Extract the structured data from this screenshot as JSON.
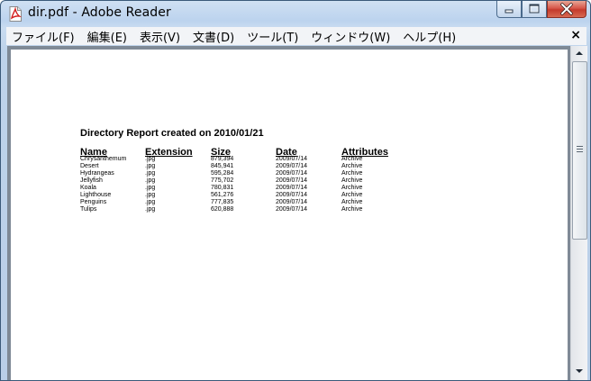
{
  "window": {
    "title": "dir.pdf - Adobe Reader"
  },
  "menu": {
    "items": [
      "ファイル(F)",
      "編集(E)",
      "表示(V)",
      "文書(D)",
      "ツール(T)",
      "ウィンドウ(W)",
      "ヘルプ(H)"
    ],
    "close_glyph": "×"
  },
  "report": {
    "title": "Directory Report created on 2010/01/21",
    "headers": [
      "Name",
      "Extension",
      "Size",
      "Date",
      "Attributes"
    ],
    "rows": [
      [
        "Chrysanthemum",
        ".jpg",
        "879,394",
        "2009/07/14",
        "Archive"
      ],
      [
        "Desert",
        ".jpg",
        "845,941",
        "2009/07/14",
        "Archive"
      ],
      [
        "Hydrangeas",
        ".jpg",
        "595,284",
        "2009/07/14",
        "Archive"
      ],
      [
        "Jellyfish",
        ".jpg",
        "775,702",
        "2009/07/14",
        "Archive"
      ],
      [
        "Koala",
        ".jpg",
        "780,831",
        "2009/07/14",
        "Archive"
      ],
      [
        "Lighthouse",
        ".jpg",
        "561,276",
        "2009/07/14",
        "Archive"
      ],
      [
        "Penguins",
        ".jpg",
        "777,835",
        "2009/07/14",
        "Archive"
      ],
      [
        "Tulips",
        ".jpg",
        "620,888",
        "2009/07/14",
        "Archive"
      ]
    ]
  },
  "icons": {
    "app": "pdf-file-icon",
    "minimize": "minimize-icon",
    "maximize": "maximize-icon",
    "close": "close-icon",
    "scroll_up": "arrow-up-icon",
    "scroll_down": "arrow-down-icon"
  },
  "colors": {
    "title_bar": "#bcd3ee",
    "close_button": "#c43a2c",
    "pdf_red": "#d32020"
  }
}
